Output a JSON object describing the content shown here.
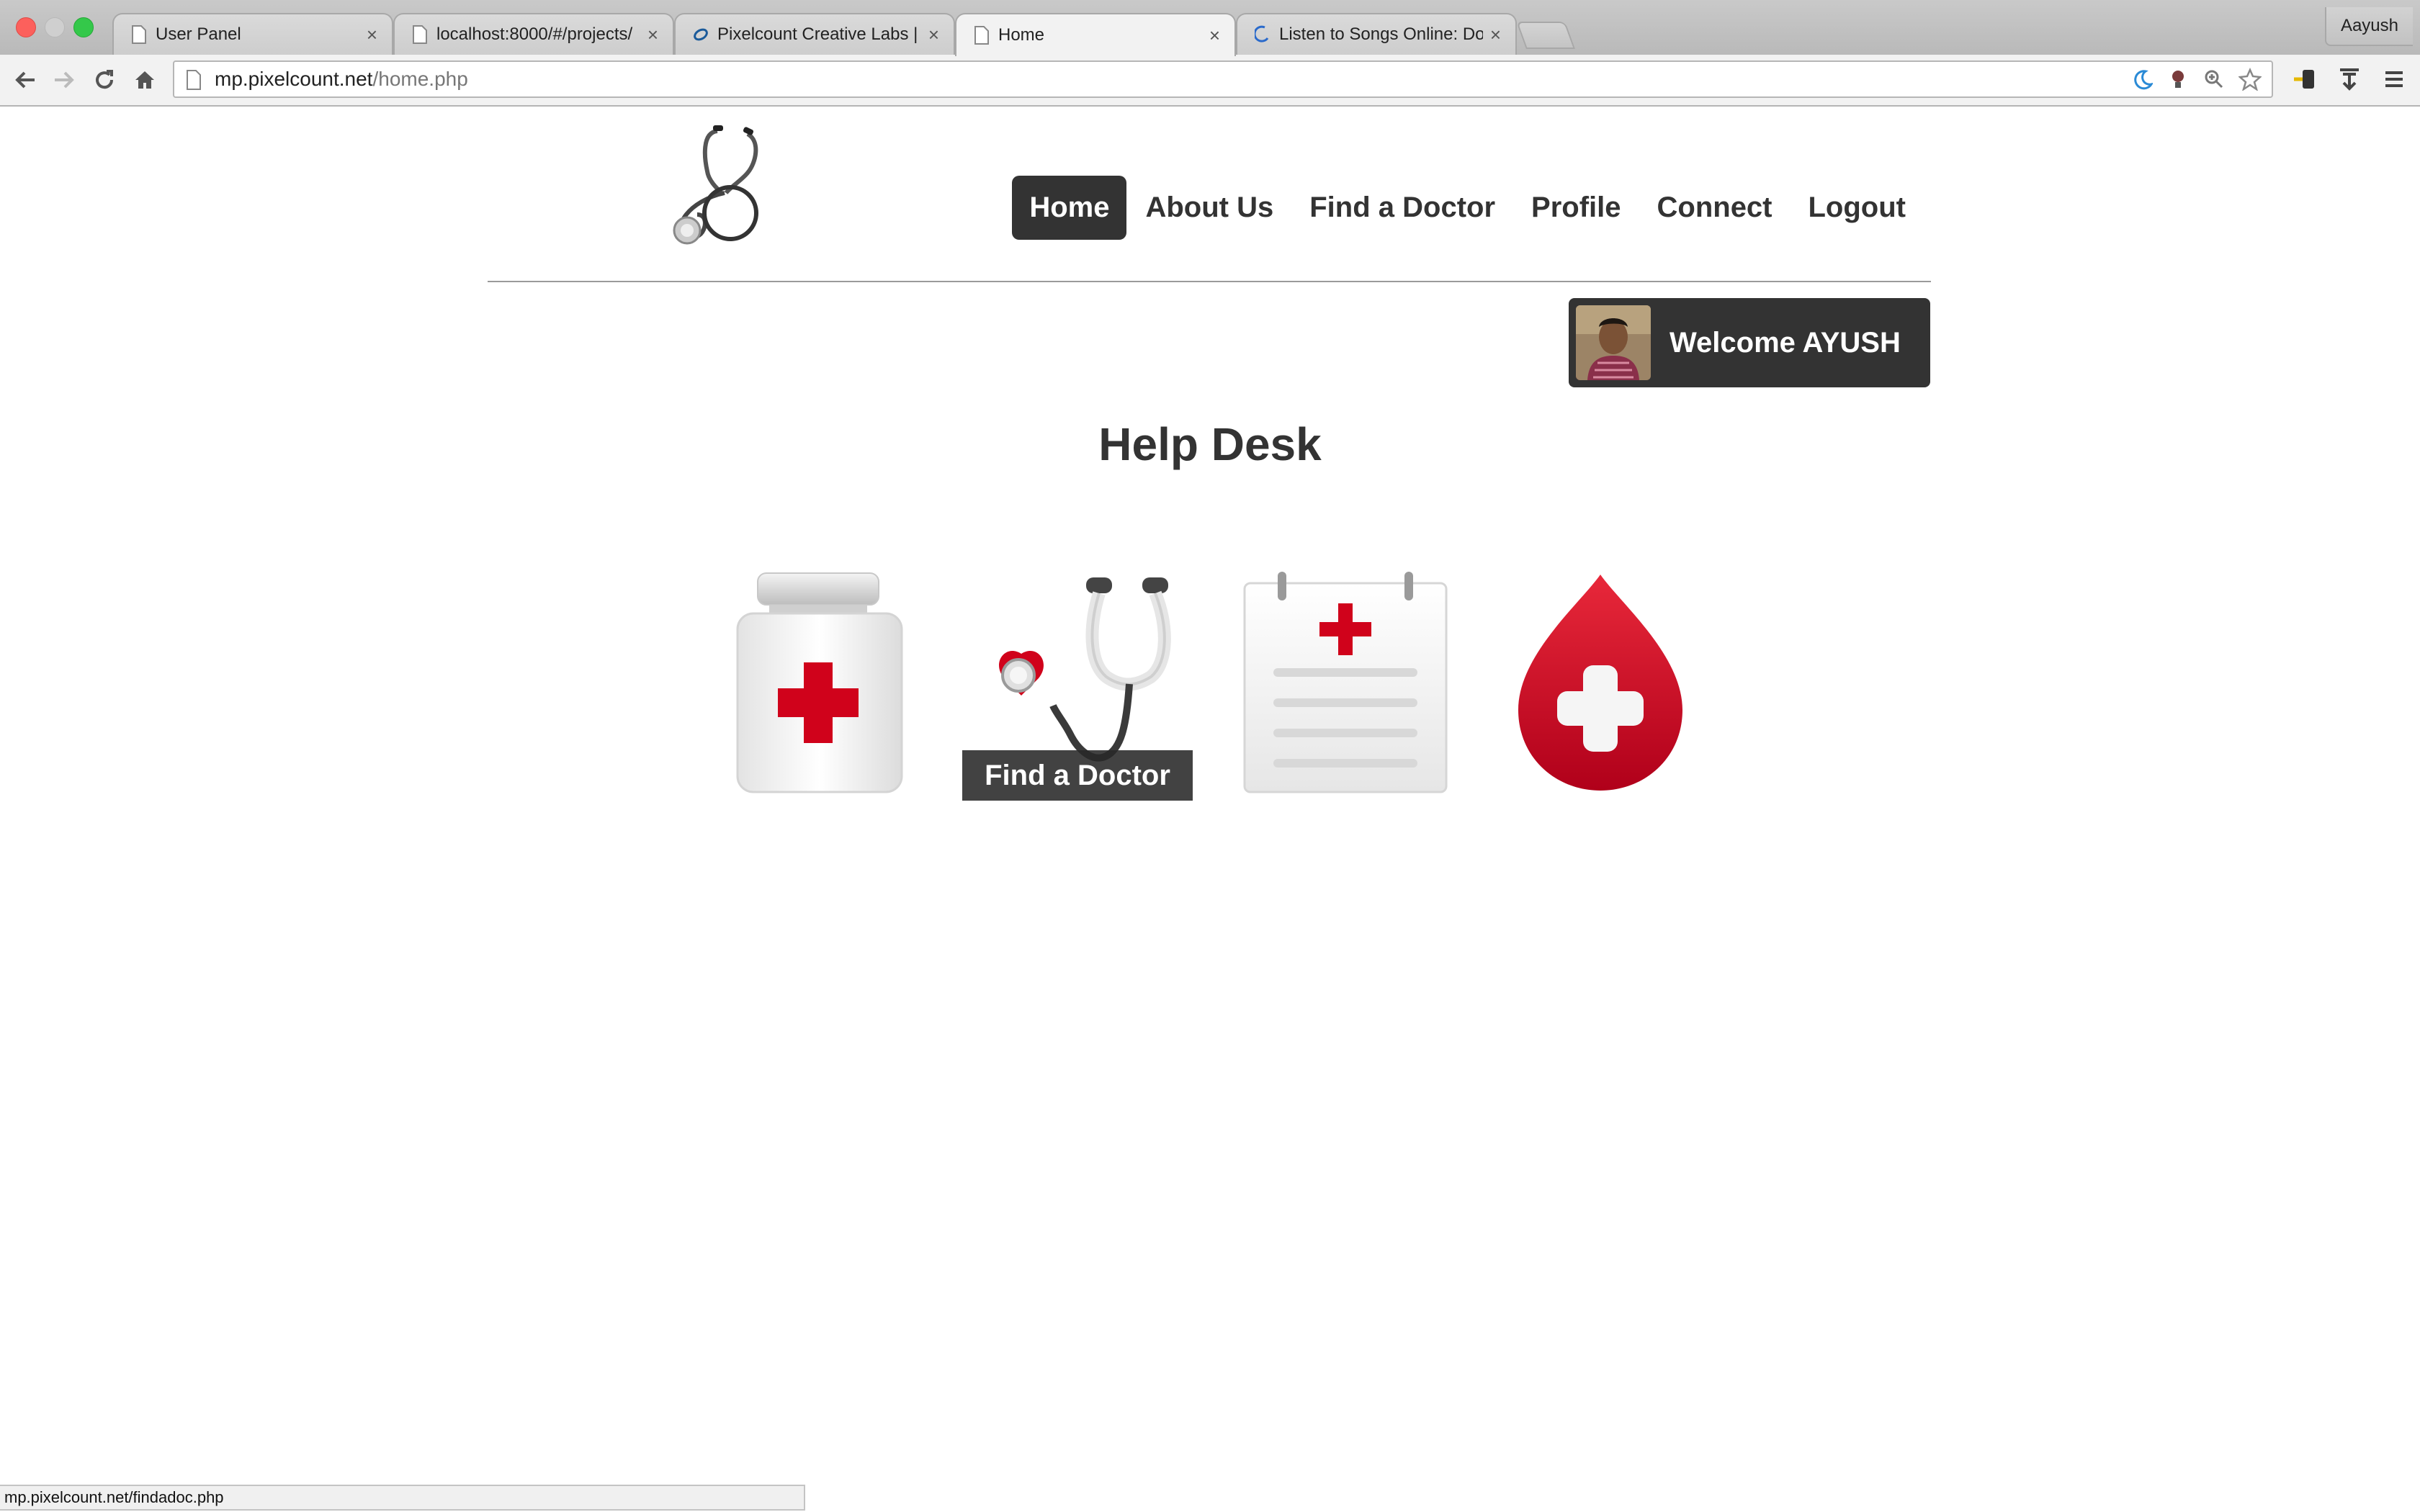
{
  "browser": {
    "tabs": [
      {
        "title": "User Panel",
        "icon": "page-icon",
        "active": false
      },
      {
        "title": "localhost:8000/#/projects/",
        "icon": "page-icon",
        "active": false
      },
      {
        "title": "Pixelcount Creative Labs | W",
        "icon": "pixelcount-icon",
        "active": false
      },
      {
        "title": "Home",
        "icon": "page-icon",
        "active": true
      },
      {
        "title": "Listen to Songs Online: Do",
        "icon": "loading-icon",
        "active": false
      }
    ],
    "close_glyph": "×",
    "profile_name": "Aayush",
    "url_host": "mp.pixelcount.net",
    "url_path": "/home.php",
    "status_url": "mp.pixelcount.net/findadoc.php"
  },
  "site": {
    "nav": [
      {
        "label": "Home",
        "active": true
      },
      {
        "label": "About Us",
        "active": false
      },
      {
        "label": "Find a Doctor",
        "active": false
      },
      {
        "label": "Profile",
        "active": false
      },
      {
        "label": "Connect",
        "active": false
      },
      {
        "label": "Logout",
        "active": false
      }
    ],
    "welcome": "Welcome AYUSH",
    "title": "Help Desk",
    "tiles": [
      {
        "icon": "medicine-bottle-icon"
      },
      {
        "icon": "stethoscope-heart-icon",
        "caption": "Find a Doctor"
      },
      {
        "icon": "medical-notepad-icon"
      },
      {
        "icon": "blood-drop-icon"
      }
    ]
  },
  "colors": {
    "accent_dark": "#333333",
    "medical_red": "#d0021b"
  }
}
